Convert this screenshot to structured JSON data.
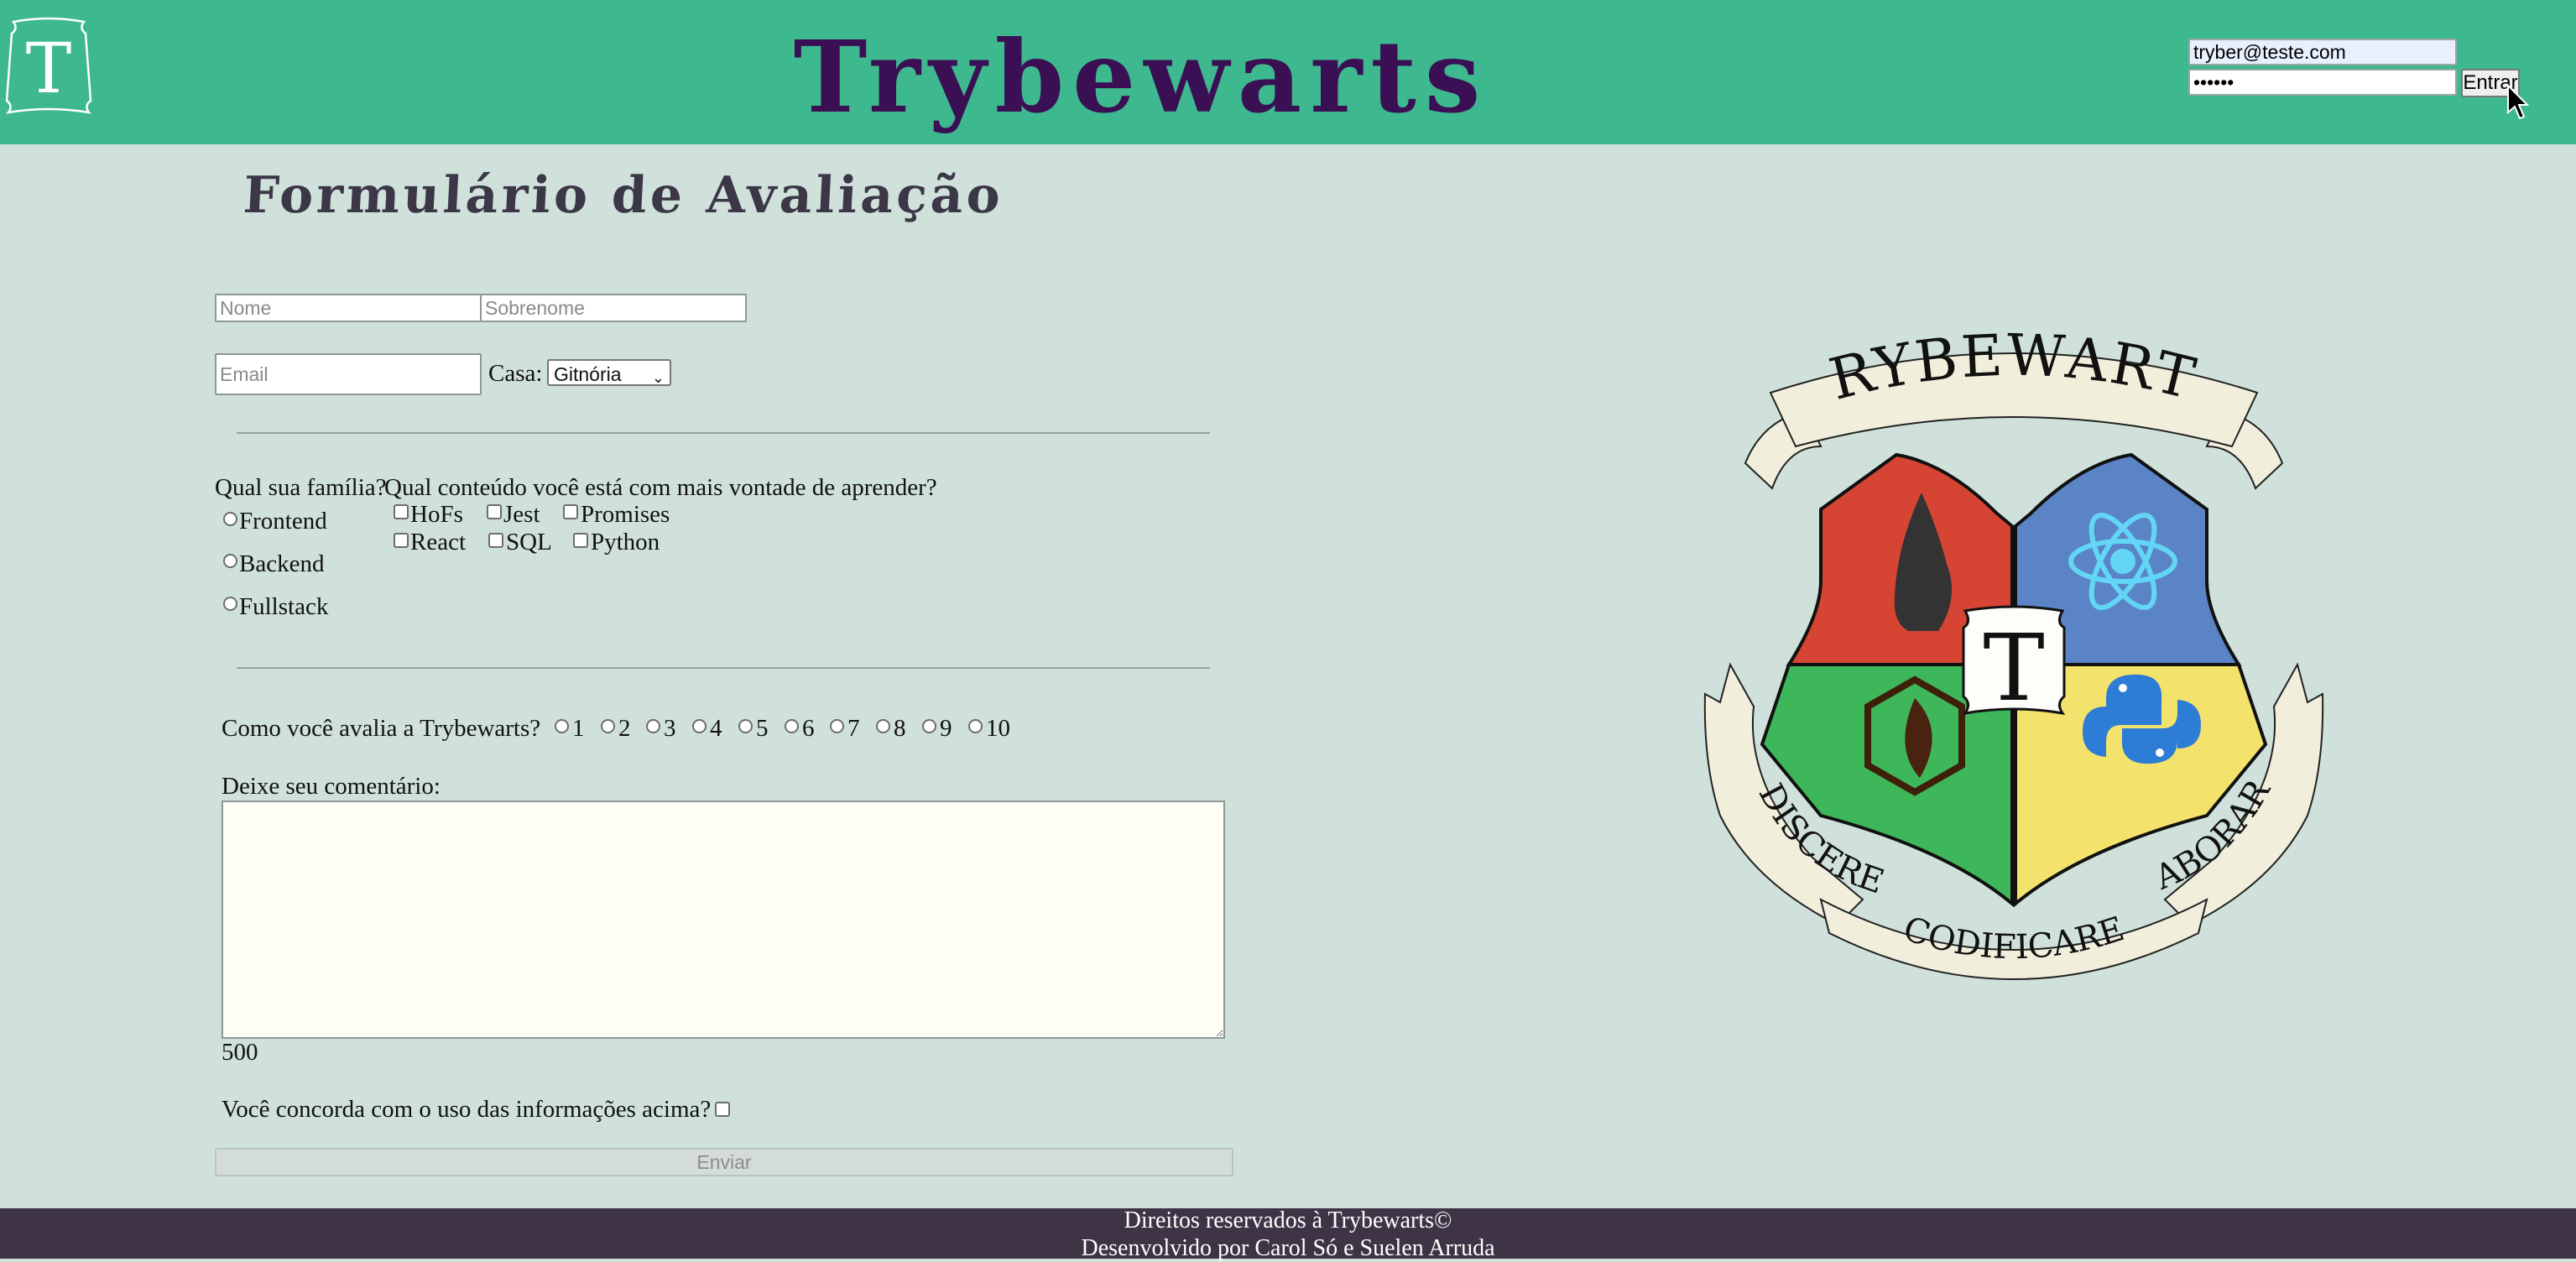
{
  "header": {
    "logo_letter": "T",
    "brand": "Trybewarts",
    "login": {
      "email_value": "tryber@teste.com",
      "password_value": "••••••",
      "submit_label": "Entrar"
    }
  },
  "form": {
    "title": "Formulário de Avaliação",
    "name_placeholder": "Nome",
    "lastname_placeholder": "Sobrenome",
    "email_placeholder": "Email",
    "house_label": "Casa:",
    "house_selected": "Gitnória",
    "family_question": "Qual sua família?",
    "family_options": [
      "Frontend",
      "Backend",
      "Fullstack"
    ],
    "content_question": "Qual conteúdo você está com mais vontade de aprender?",
    "content_options": [
      "HoFs",
      "Jest",
      "Promises",
      "React",
      "SQL",
      "Python"
    ],
    "rating_question": "Como você avalia a Trybewarts?",
    "rating_options": [
      "1",
      "2",
      "3",
      "4",
      "5",
      "6",
      "7",
      "8",
      "9",
      "10"
    ],
    "comment_label": "Deixe seu comentário:",
    "char_counter": "500",
    "agreement_label": "Você concorda com o uso das informações acima?",
    "submit_label": "Enviar"
  },
  "crest": {
    "banner_top": "TRYBEWARTS",
    "banner_left": "DISCERE",
    "banner_bottom": "CODIFICARE",
    "banner_right": "LABORARE",
    "center_letter": "T"
  },
  "footer": {
    "line1": "Direitos reservados à Trybewarts©",
    "line2": "Desenvolvido por Carol Só e Suelen Arruda"
  },
  "colors": {
    "header_bg": "#3eb88f",
    "page_bg": "#cfe1da",
    "brand_text": "#3b0f54",
    "footer_bg": "#3f3446",
    "crest_red": "#d64433",
    "crest_blue": "#5b84c7",
    "crest_green": "#3eb65a",
    "crest_yellow": "#f3e26b"
  }
}
